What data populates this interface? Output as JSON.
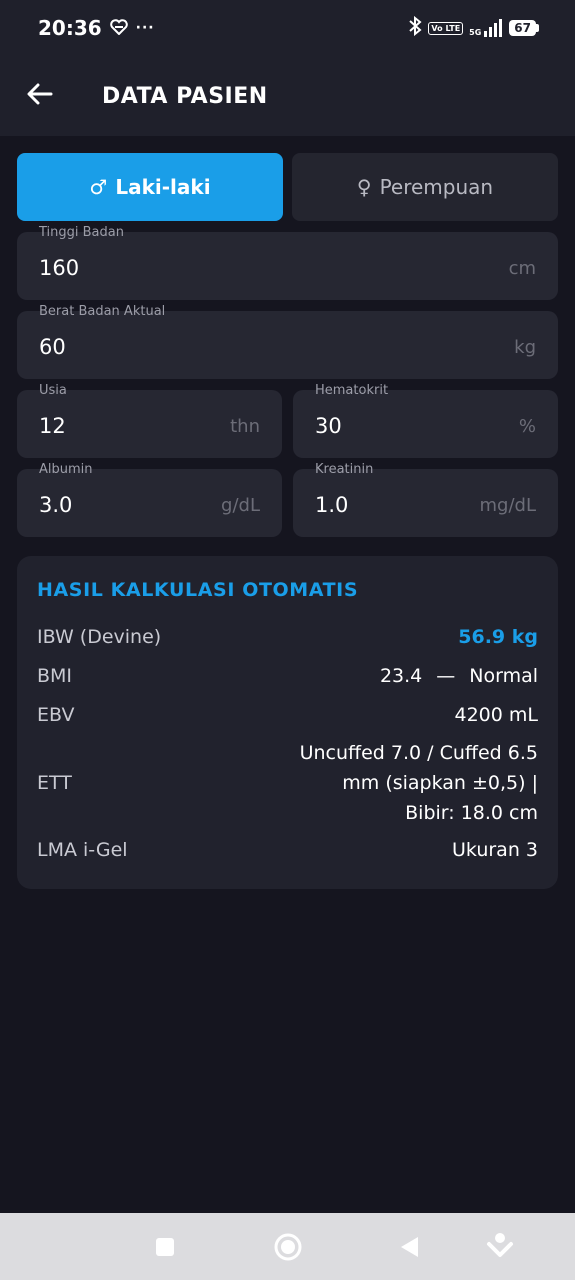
{
  "status_bar": {
    "time": "20:36",
    "dots": "···",
    "volte": "Vo LTE",
    "network": "5G",
    "battery": "67"
  },
  "app_bar": {
    "title": "DATA PASIEN",
    "back_icon": "arrow-left-icon"
  },
  "gender": {
    "male_symbol": "♂",
    "male_label": "Laki-laki",
    "female_symbol": "♀",
    "female_label": "Perempuan",
    "selected": "male"
  },
  "fields": {
    "height": {
      "label": "Tinggi Badan",
      "value": "160",
      "unit": "cm"
    },
    "weight": {
      "label": "Berat Badan Aktual",
      "value": "60",
      "unit": "kg"
    },
    "age": {
      "label": "Usia",
      "value": "12",
      "unit": "thn"
    },
    "hematocrit": {
      "label": "Hematokrit",
      "value": "30",
      "unit": "%"
    },
    "albumin": {
      "label": "Albumin",
      "value": "3.0",
      "unit": "g/dL"
    },
    "creatinine": {
      "label": "Kreatinin",
      "value": "1.0",
      "unit": "mg/dL"
    }
  },
  "results": {
    "title": "HASIL KALKULASI OTOMATIS",
    "ibw": {
      "key": "IBW (Devine)",
      "value": "56.9 kg"
    },
    "bmi": {
      "key": "BMI",
      "value": "23.4",
      "dash": "—",
      "category": "Normal"
    },
    "ebv": {
      "key": "EBV",
      "value": "4200 mL"
    },
    "ett": {
      "key": "ETT",
      "value": "Uncuffed 7.0 / Cuffed 6.5 mm (siapkan ±0,5) | Bibir: 18.0 cm"
    },
    "lma": {
      "key": "LMA i-Gel",
      "value": "Ukuran 3"
    }
  },
  "colors": {
    "accent": "#1a9ee8",
    "background": "#15151f",
    "card": "#262732"
  }
}
